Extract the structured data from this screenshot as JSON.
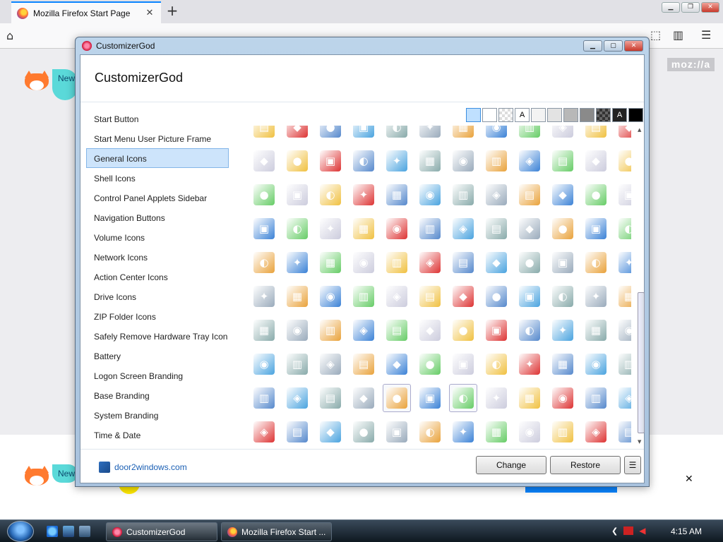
{
  "browser": {
    "tab_title": "Mozilla Firefox Start Page",
    "close_tab": "✕",
    "new_tab": "+",
    "mozilla_logo": "moz://a",
    "bubble_text": "New"
  },
  "dialog": {
    "titlebar": "CustomizerGod",
    "header": "CustomizerGod",
    "nav_items": [
      "Start Button",
      "Start Menu User Picture Frame",
      "General Icons",
      "Shell Icons",
      "Control Panel Applets Sidebar",
      "Navigation Buttons",
      "Volume Icons",
      "Network Icons",
      "Action Center Icons",
      "Drive Icons",
      "ZIP Folder Icons",
      "Safely Remove Hardware Tray Icon",
      "Battery",
      "Logon Screen Branding",
      "Base Branding",
      "System Branding",
      "Time & Date"
    ],
    "selected_nav": "General Icons",
    "swatch_letter": "A",
    "footer_link": "door2windows.com",
    "change_button": "Change",
    "restore_button": "Restore",
    "menu_button": "☰"
  },
  "taskbar": {
    "items": [
      "CustomizerGod",
      "Mozilla Firefox Start ..."
    ],
    "clock": "4:15 AM"
  }
}
